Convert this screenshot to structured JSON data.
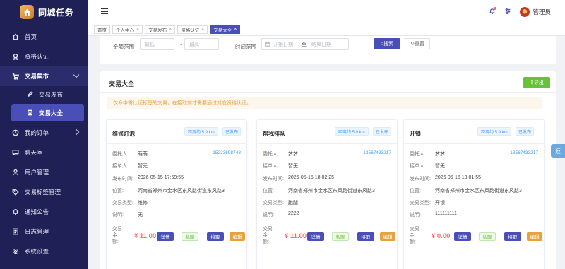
{
  "brand": {
    "title": "同城任务",
    "logo_icon": "house-logo-icon"
  },
  "sidebar": {
    "items": [
      {
        "label": "首页",
        "icon": "home-icon"
      },
      {
        "label": "资格认证",
        "icon": "certificate-icon"
      },
      {
        "label": "交易集市",
        "icon": "cart-icon"
      },
      {
        "label": "我的订单",
        "icon": "order-icon"
      },
      {
        "label": "聊天室",
        "icon": "chat-icon"
      },
      {
        "label": "用户管理",
        "icon": "user-icon"
      },
      {
        "label": "交易标签管理",
        "icon": "tag-icon"
      },
      {
        "label": "通知公告",
        "icon": "bell-icon"
      },
      {
        "label": "日志管理",
        "icon": "log-icon"
      },
      {
        "label": "系统设置",
        "icon": "gear-icon"
      }
    ],
    "sub_items": [
      {
        "label": "交易发布",
        "icon": "edit-icon"
      },
      {
        "label": "交易大全",
        "icon": "list-icon"
      }
    ]
  },
  "header": {
    "user_name": "管理员",
    "accent": "#4a4fb8"
  },
  "tabs": [
    {
      "label": "首页"
    },
    {
      "label": "个人中心"
    },
    {
      "label": "交易发布"
    },
    {
      "label": "资格认证"
    },
    {
      "label": "交易大全"
    }
  ],
  "filters": {
    "amount_label": "金额范围",
    "min_placeholder": "最低",
    "max_placeholder": "最高",
    "range_sep": "-",
    "time_label": "时间范围",
    "start_placeholder": "开始日期",
    "date_sep": "至",
    "end_placeholder": "结束日期",
    "search_label": "搜索",
    "reset_label": "重置"
  },
  "list": {
    "title": "交易大全",
    "export_label": "导出",
    "notice": "仅命中需认证标签的交易，在接取前才需要通过对应资格认证。"
  },
  "card_labels": {
    "client": "委托人:",
    "taker": "接单人:",
    "time": "发布时间:",
    "location": "位置:",
    "type": "交易类型:",
    "desc": "说明:",
    "amount": [
      "交易",
      "金",
      "额:"
    ],
    "detail": "详情",
    "private": "私聊",
    "take": "接取",
    "edit": "编辑"
  },
  "cards": [
    {
      "title": "维修灯泡",
      "distance": "距离约 5.9 km",
      "status": "已发布",
      "client": "萌萌",
      "phone": "15233698748",
      "taker": "暂无",
      "time": "2026-05-15 17:59:55",
      "location": "河南省郑州市金水区东风路街道东风路3",
      "type": "维修",
      "desc": "无",
      "amount": "¥ 11.00"
    },
    {
      "title": "帮我排队",
      "distance": "距离约 5.9 km",
      "status": "已发布",
      "client": "梦梦",
      "phone": "13567433217",
      "taker": "暂无",
      "time": "2026-05-15 18:02:25",
      "location": "河南省郑州市金水区东风路街道东风路3",
      "type": "跑腿",
      "desc": "2222",
      "amount": "¥ 11.00"
    },
    {
      "title": "开锁",
      "distance": "距离约 5.9 km",
      "status": "已发布",
      "client": "梦梦",
      "phone": "13567433217",
      "taker": "暂无",
      "time": "2026-05-15 18:01:55",
      "location": "河南省郑州市金水区东风路街道东风路3",
      "type": "开锁",
      "desc": "111111111",
      "amount": "¥ 0.00"
    }
  ],
  "float_button": "逗"
}
